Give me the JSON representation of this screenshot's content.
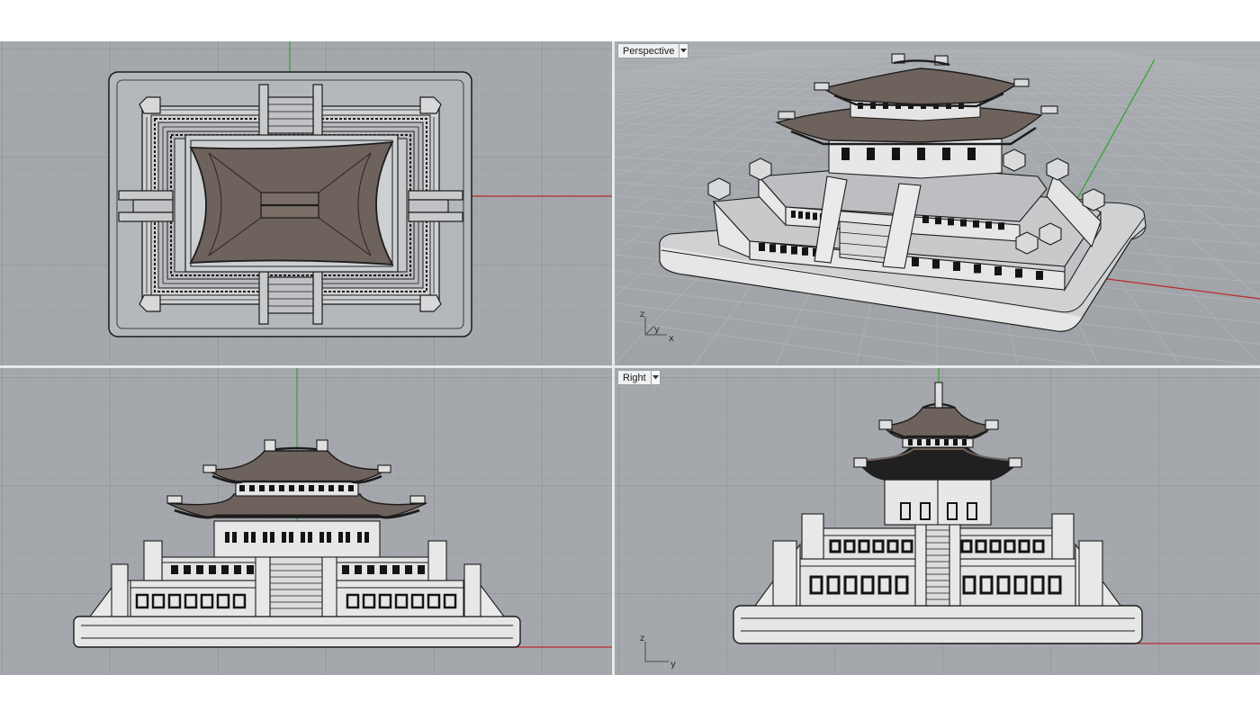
{
  "viewports": {
    "top": {
      "label": ""
    },
    "perspective": {
      "label": "Perspective"
    },
    "front": {
      "label": ""
    },
    "right": {
      "label": "Right"
    }
  },
  "axis_triads": {
    "perspective": {
      "a": "z",
      "b": "y",
      "c": "x"
    },
    "right": {
      "a": "z",
      "b": "y"
    }
  },
  "colors": {
    "viewport_bg": "#a3a6ab",
    "grid_minor": "#b1b4b8",
    "grid_major": "#8b8e92",
    "axis_x": "#b82a2a",
    "axis_y": "#2fa52f",
    "roof": "#6e625c",
    "wall": "#e6e6e6",
    "outline": "#1c1c1c",
    "window": "#141414"
  },
  "icons": {
    "dropdown": "chevron-down-icon"
  }
}
